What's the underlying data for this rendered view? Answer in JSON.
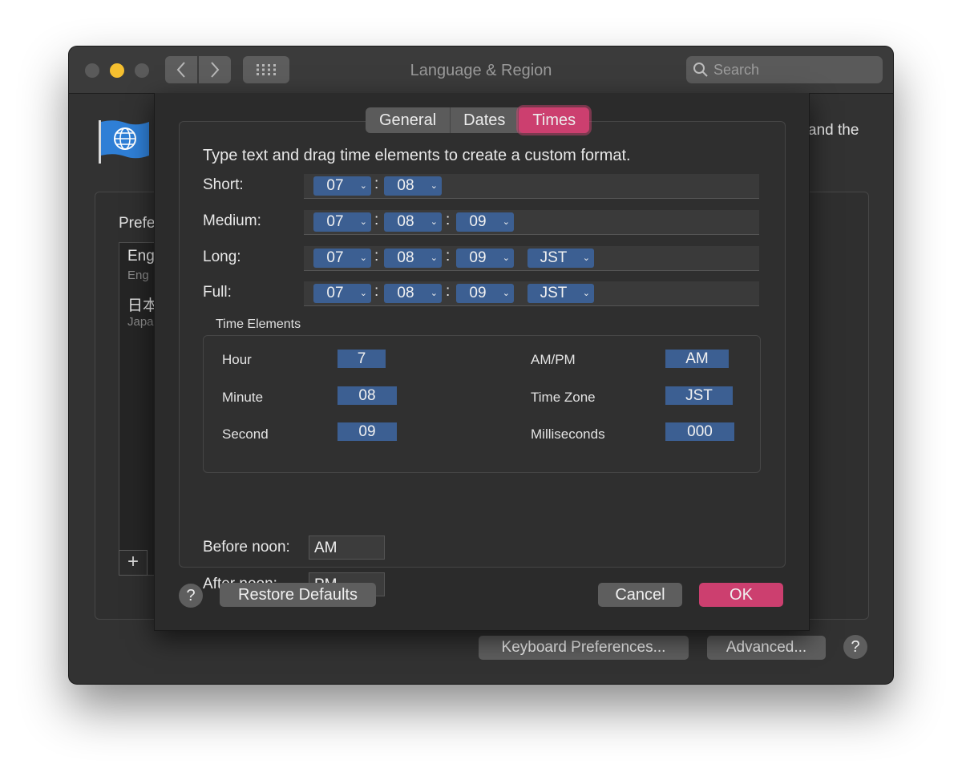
{
  "window": {
    "title": "Language & Region"
  },
  "search": {
    "placeholder": "Search"
  },
  "background": {
    "partial_text": "and the",
    "preferred_label_partial": "Prefe",
    "languages": [
      {
        "name": "Eng",
        "sub": "Eng"
      },
      {
        "name": "日本",
        "sub": "Japa"
      }
    ],
    "add_label": "+",
    "keyboard_prefs": "Keyboard Preferences...",
    "advanced": "Advanced...",
    "help": "?"
  },
  "sheet": {
    "tabs": [
      {
        "label": "General",
        "selected": false
      },
      {
        "label": "Dates",
        "selected": false
      },
      {
        "label": "Times",
        "selected": true
      }
    ],
    "instruction": "Type text and drag time elements to create a custom format.",
    "formats": [
      {
        "label": "Short:",
        "tokens": [
          "07",
          "08"
        ]
      },
      {
        "label": "Medium:",
        "tokens": [
          "07",
          "08",
          "09"
        ]
      },
      {
        "label": "Long:",
        "tokens": [
          "07",
          "08",
          "09",
          "JST"
        ]
      },
      {
        "label": "Full:",
        "tokens": [
          "07",
          "08",
          "09",
          "JST"
        ]
      }
    ],
    "separator": ":",
    "time_elements": {
      "title": "Time Elements",
      "hour": {
        "label": "Hour",
        "value": "7"
      },
      "minute": {
        "label": "Minute",
        "value": "08"
      },
      "second": {
        "label": "Second",
        "value": "09"
      },
      "ampm": {
        "label": "AM/PM",
        "value": "AM"
      },
      "timezone": {
        "label": "Time Zone",
        "value": "JST"
      },
      "milliseconds": {
        "label": "Milliseconds",
        "value": "000"
      }
    },
    "before_noon": {
      "label": "Before noon:",
      "value": "AM"
    },
    "after_noon": {
      "label": "After noon:",
      "value": "PM"
    },
    "help": "?",
    "restore_defaults": "Restore Defaults",
    "cancel": "Cancel",
    "ok": "OK"
  },
  "colors": {
    "accent": "#cc3f6f",
    "token": "#3c5f92",
    "minimize": "#f5bf2f"
  }
}
